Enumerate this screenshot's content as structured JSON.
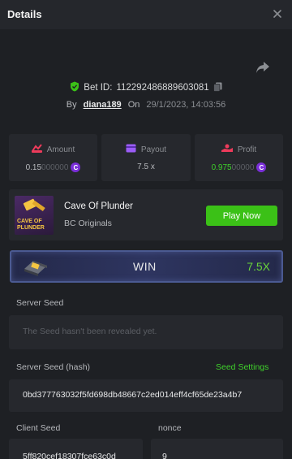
{
  "header": {
    "title": "Details"
  },
  "bet": {
    "id_label": "Bet ID:",
    "id_value": "112292486889603081",
    "by_label": "By",
    "username": "diana189",
    "on_label": "On",
    "datetime": "29/1/2023, 14:03:56"
  },
  "stats": {
    "amount": {
      "label": "Amount",
      "value_main": "0.15",
      "value_dim": "000000"
    },
    "payout": {
      "label": "Payout",
      "value": "7.5 x"
    },
    "profit": {
      "label": "Profit",
      "value_main": "0.975",
      "value_dim": "00000"
    }
  },
  "game": {
    "thumb_text": "CAVE OF PLUNDER",
    "name": "Cave Of Plunder",
    "provider": "BC Originals",
    "play_label": "Play Now"
  },
  "result": {
    "label": "WIN",
    "multiplier": "7.5X"
  },
  "server_seed": {
    "label": "Server Seed",
    "placeholder": "The Seed hasn't been revealed yet."
  },
  "server_seed_hash": {
    "label": "Server Seed (hash)",
    "settings_label": "Seed Settings",
    "value": "0bd377763032f5fd698db48667c2ed014eff4cf65de23a4b7"
  },
  "client_seed": {
    "label": "Client Seed",
    "value": "5ff820cef18307fce63c0d"
  },
  "nonce": {
    "label": "nonce",
    "value": "9"
  },
  "colors": {
    "accent_green": "#3bc117",
    "coin_purple": "#7b2fd9",
    "background": "#1e2024",
    "card": "#26282d"
  },
  "icons": {
    "close": "close-icon",
    "share": "share-icon",
    "shield": "shield-check-icon",
    "copy": "copy-icon",
    "amount": "amount-icon",
    "payout": "wallet-icon",
    "profit": "profit-icon",
    "coin": "coin-icon"
  }
}
